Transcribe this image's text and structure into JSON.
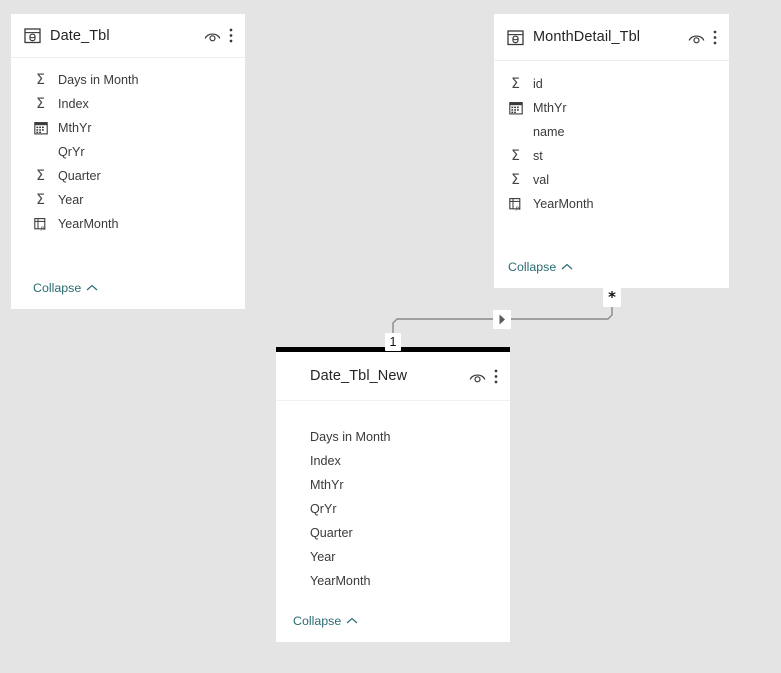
{
  "app": {
    "view": "model-view",
    "canvas_background": "#e4e4e4",
    "card_background": "#ffffff",
    "link_color": "#2a6b72",
    "text_color": "#3b3a39",
    "selection_border_color": "#000000"
  },
  "tables": [
    {
      "id": "date-tbl",
      "name": "Date_Tbl",
      "has_table_icon": true,
      "selected": false,
      "collapse_label": "Collapse",
      "eye_icon": "eye-icon",
      "kebab_icon": "more-options-icon",
      "fields": [
        {
          "name": "Days in Month",
          "icon": "sum-icon"
        },
        {
          "name": "Index",
          "icon": "sum-icon"
        },
        {
          "name": "MthYr",
          "icon": "calendar-icon"
        },
        {
          "name": "QrYr",
          "icon": "none"
        },
        {
          "name": "Quarter",
          "icon": "sum-icon"
        },
        {
          "name": "Year",
          "icon": "sum-icon"
        },
        {
          "name": "YearMonth",
          "icon": "calculated-column-icon"
        }
      ]
    },
    {
      "id": "monthdetail-tbl",
      "name": "MonthDetail_Tbl",
      "has_table_icon": true,
      "selected": false,
      "collapse_label": "Collapse",
      "eye_icon": "eye-icon",
      "kebab_icon": "more-options-icon",
      "fields": [
        {
          "name": "id",
          "icon": "sum-icon"
        },
        {
          "name": "MthYr",
          "icon": "calendar-icon"
        },
        {
          "name": "name",
          "icon": "none"
        },
        {
          "name": "st",
          "icon": "sum-icon"
        },
        {
          "name": "val",
          "icon": "sum-icon"
        },
        {
          "name": "YearMonth",
          "icon": "calculated-column-icon"
        }
      ]
    },
    {
      "id": "date-tbl-new",
      "name": "Date_Tbl_New",
      "has_table_icon": false,
      "selected": true,
      "collapse_label": "Collapse",
      "eye_icon": "eye-icon",
      "kebab_icon": "more-options-icon",
      "fields": [
        {
          "name": "Days in Month",
          "icon": "none"
        },
        {
          "name": "Index",
          "icon": "none"
        },
        {
          "name": "MthYr",
          "icon": "none"
        },
        {
          "name": "QrYr",
          "icon": "none"
        },
        {
          "name": "Quarter",
          "icon": "none"
        },
        {
          "name": "Year",
          "icon": "none"
        },
        {
          "name": "YearMonth",
          "icon": "none"
        }
      ]
    }
  ],
  "relationship": {
    "from_table": "Date_Tbl_New",
    "to_table": "MonthDetail_Tbl",
    "from_cardinality": "1",
    "to_cardinality": "*",
    "cross_filter_direction": "single",
    "arrow_icon": "filter-direction-arrow-icon"
  }
}
